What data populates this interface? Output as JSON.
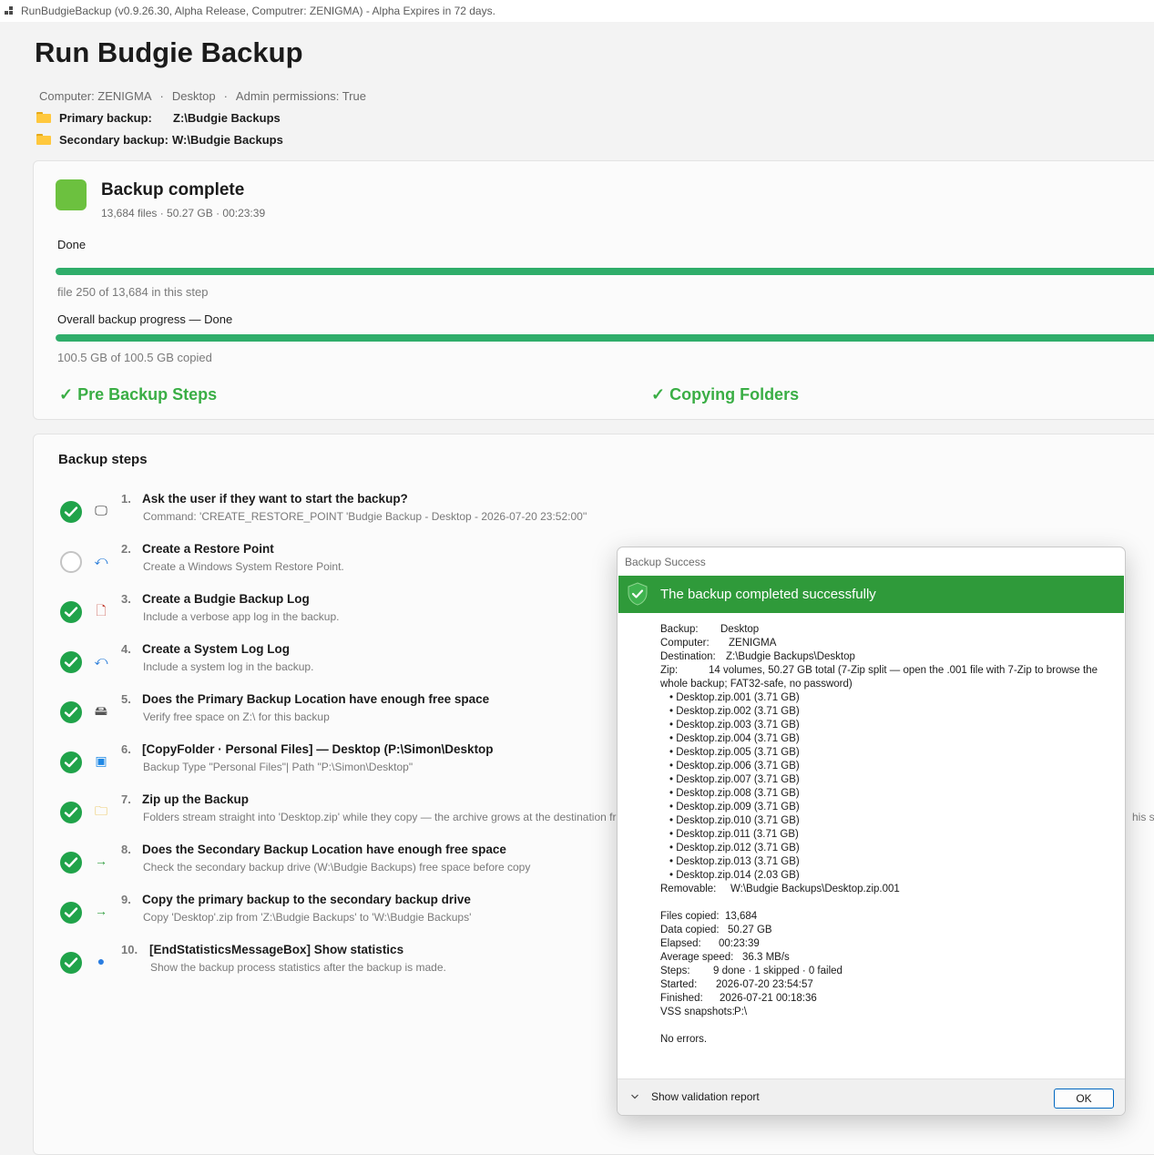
{
  "window": {
    "title": "RunBudgieBackup (v0.9.26.30, Alpha Release, Computrer: ZENIGMA) - Alpha Expires in 72 days."
  },
  "header": {
    "title": "Run Budgie Backup",
    "meta": {
      "computer": "Computer: ZENIGMA",
      "profile": "Desktop",
      "admin": "Admin permissions: True",
      "separator": "·"
    },
    "primary": {
      "label": "Primary backup:",
      "value": "Z:\\Budgie Backups"
    },
    "secondary": {
      "label": "Secondary backup:",
      "value": "W:\\Budgie Backups"
    }
  },
  "status": {
    "title": "Backup complete",
    "subtitle": "13,684 files · 50.27 GB · 00:23:39",
    "color": "#6cc13f",
    "step_label": "Done",
    "step_progress": 1.0,
    "step_caption": "file 250 of 13,684 in this step",
    "overall_label": "Overall backup progress — Done",
    "overall_progress": 1.0,
    "overall_caption": "100.5 GB of 100.5 GB copied",
    "phases": [
      "✓ Pre Backup Steps",
      "✓ Copying Folders"
    ]
  },
  "steps": {
    "title": "Backup steps",
    "items": [
      {
        "num": "1.",
        "name": "Ask the user if they want to start the backup?",
        "desc": "Command: 'CREATE_RESTORE_POINT 'Budgie Backup - Desktop - 2026-07-20 23:52:00''",
        "state": "done",
        "icon": "monitor-icon"
      },
      {
        "num": "2.",
        "name": "Create a Restore Point",
        "desc": "Create a Windows System Restore Point.",
        "state": "skipped",
        "icon": "undo-icon"
      },
      {
        "num": "3.",
        "name": "Create a Budgie Backup Log",
        "desc": "Include a verbose app log in the backup.",
        "state": "done",
        "icon": "log-file-icon"
      },
      {
        "num": "4.",
        "name": "Create a System Log Log",
        "desc": "Include a system log in the backup.",
        "state": "done",
        "icon": "undo-icon"
      },
      {
        "num": "5.",
        "name": "Does the Primary Backup Location have enough free space",
        "desc": "Verify free space on Z:\\ for this backup",
        "state": "done",
        "icon": "drive-icon"
      },
      {
        "num": "6.",
        "name": "[CopyFolder · Personal Files] — Desktop (P:\\Simon\\Desktop",
        "desc": "Backup Type \"Personal Files\"| Path \"P:\\Simon\\Desktop\"",
        "state": "done",
        "icon": "desktop-icon"
      },
      {
        "num": "7.",
        "name": "Zip up the Backup",
        "desc": "Folders stream straight into 'Desktop.zip' while they copy — the archive grows at the destination fro",
        "tail": "his ste",
        "state": "done",
        "icon": "zip-folder-icon"
      },
      {
        "num": "8.",
        "name": "Does the Secondary Backup Location have enough free space",
        "desc": "Check the secondary backup drive (W:\\Budgie Backups) free space before copy",
        "state": "done",
        "icon": "arrow-right-icon"
      },
      {
        "num": "9.",
        "name": "Copy the primary backup to the secondary backup drive",
        "desc": "Copy 'Desktop'.zip from 'Z:\\Budgie Backups' to 'W:\\Budgie Backups'",
        "state": "done",
        "icon": "arrow-right-icon"
      },
      {
        "num": "10.",
        "name": "[EndStatisticsMessageBox] Show statistics",
        "desc": "Show the backup process statistics after the backup is made.",
        "state": "done",
        "icon": "globe-icon"
      }
    ]
  },
  "dialog": {
    "title": "Backup Success",
    "banner": "The backup completed successfully",
    "banner_color": "#2f9a3a",
    "backup_label": "Backup:",
    "backup": "Desktop",
    "computer_label": "Computer:",
    "computer": "ZENIGMA",
    "destination_label": "Destination:",
    "destination": "Z:\\Budgie Backups\\Desktop",
    "zip_label": "Zip:",
    "zip": "14 volumes, 50.27 GB total (7-Zip split — open the .001 file with 7-Zip to browse the whole backup; FAT32-safe, no password)",
    "files": [
      "• Desktop.zip.001  (3.71 GB)",
      "• Desktop.zip.002  (3.71 GB)",
      "• Desktop.zip.003  (3.71 GB)",
      "• Desktop.zip.004  (3.71 GB)",
      "• Desktop.zip.005  (3.71 GB)",
      "• Desktop.zip.006  (3.71 GB)",
      "• Desktop.zip.007  (3.71 GB)",
      "• Desktop.zip.008  (3.71 GB)",
      "• Desktop.zip.009  (3.71 GB)",
      "• Desktop.zip.010  (3.71 GB)",
      "• Desktop.zip.011  (3.71 GB)",
      "• Desktop.zip.012  (3.71 GB)",
      "• Desktop.zip.013  (3.71 GB)",
      "• Desktop.zip.014  (2.03 GB)"
    ],
    "removable_label": "Removable:",
    "removable": "W:\\Budgie Backups\\Desktop.zip.001",
    "files_copied_label": "Files copied:",
    "files_copied": "13,684",
    "data_copied_label": "Data copied:",
    "data_copied": "50.27 GB",
    "elapsed_label": "Elapsed:",
    "elapsed": "00:23:39",
    "speed_label": "Average speed:",
    "speed": "36.3 MB/s",
    "steps_label": "Steps:",
    "steps": "9 done · 1 skipped · 0 failed",
    "started_label": "Started:",
    "started": "2026-07-20 23:54:57",
    "finished_label": "Finished:",
    "finished": "2026-07-21 00:18:36",
    "vss_label": "VSS snapshots:",
    "vss": "P:\\",
    "errors": "No errors.",
    "validation_toggle": "Show validation report",
    "ok": "OK"
  }
}
